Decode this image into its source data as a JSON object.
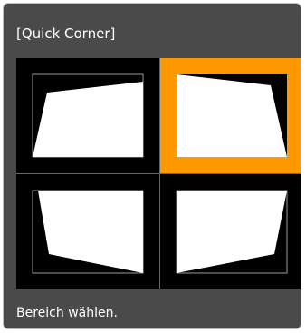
{
  "dialog": {
    "title": "[Quick Corner]",
    "instruction": "Bereich wählen."
  },
  "corners": [
    {
      "id": "top-left",
      "selected": false
    },
    {
      "id": "top-right",
      "selected": true
    },
    {
      "id": "bottom-left",
      "selected": false
    },
    {
      "id": "bottom-right",
      "selected": false
    }
  ],
  "colors": {
    "panel": "#4a4a4a",
    "grid": "#000000",
    "highlight": "#ff9900",
    "image": "#ffffff"
  }
}
